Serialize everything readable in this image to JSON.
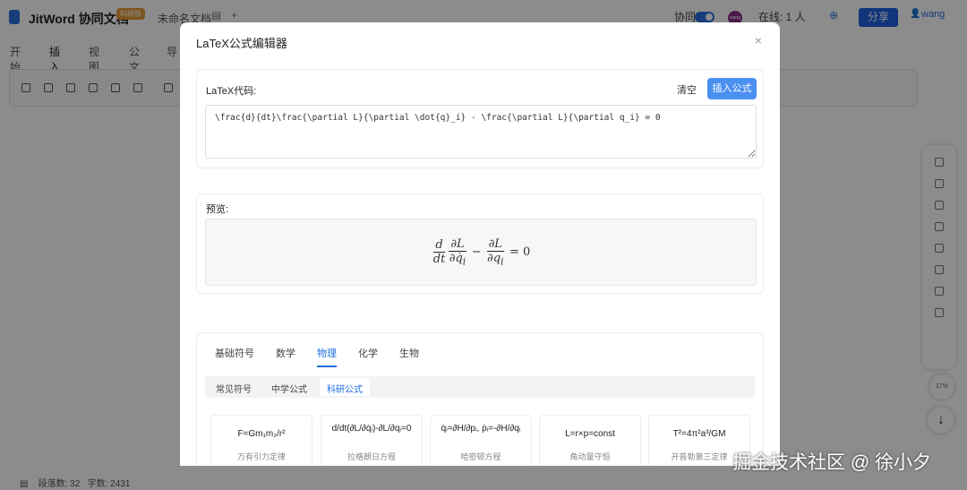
{
  "app": {
    "brand": "JitWord 协同文档",
    "badge": "科研版",
    "doc_name": "未命名文档",
    "collab_label": "协同",
    "avatar_text": "wang",
    "online": "在线: 1 人",
    "share": "分享",
    "user": "wang"
  },
  "menu": [
    "开始",
    "插入",
    "视图",
    "公文",
    "导"
  ],
  "status": {
    "paragraphs": "段落数: 32",
    "chars": "字数: 2431"
  },
  "zoom_level": "17%",
  "modal": {
    "title": "LaTeX公式编辑器",
    "close": "×",
    "code_label": "LaTeX代码:",
    "clear": "清空",
    "insert": "插入公式",
    "code": "\\frac{d}{dt}\\frac{\\partial L}{\\partial \\dot{q}_i} - \\frac{\\partial L}{\\partial q_i} = 0",
    "preview_label": "预览:",
    "tabs": [
      "基础符号",
      "数学",
      "物理",
      "化学",
      "生物"
    ],
    "subtabs": [
      "常见符号",
      "中学公式",
      "科研公式"
    ],
    "formulas": [
      {
        "f": "F=Gm₁m₂/r²",
        "d": "万有引力定律"
      },
      {
        "f": "d/dt(∂L/∂q̇ᵢ)-∂L/∂qᵢ=0",
        "d": "拉格朗日方程"
      },
      {
        "f": "q̇ᵢ=∂H/∂pᵢ, ṗᵢ=-∂H/∂qᵢ",
        "d": "哈密顿方程"
      },
      {
        "f": "L=r×p=const",
        "d": "角动量守恒"
      },
      {
        "f": "T²=4π²a³/GM",
        "d": "开普勒第三定律"
      }
    ]
  },
  "watermark": "掘金技术社区 @ 徐小夕"
}
